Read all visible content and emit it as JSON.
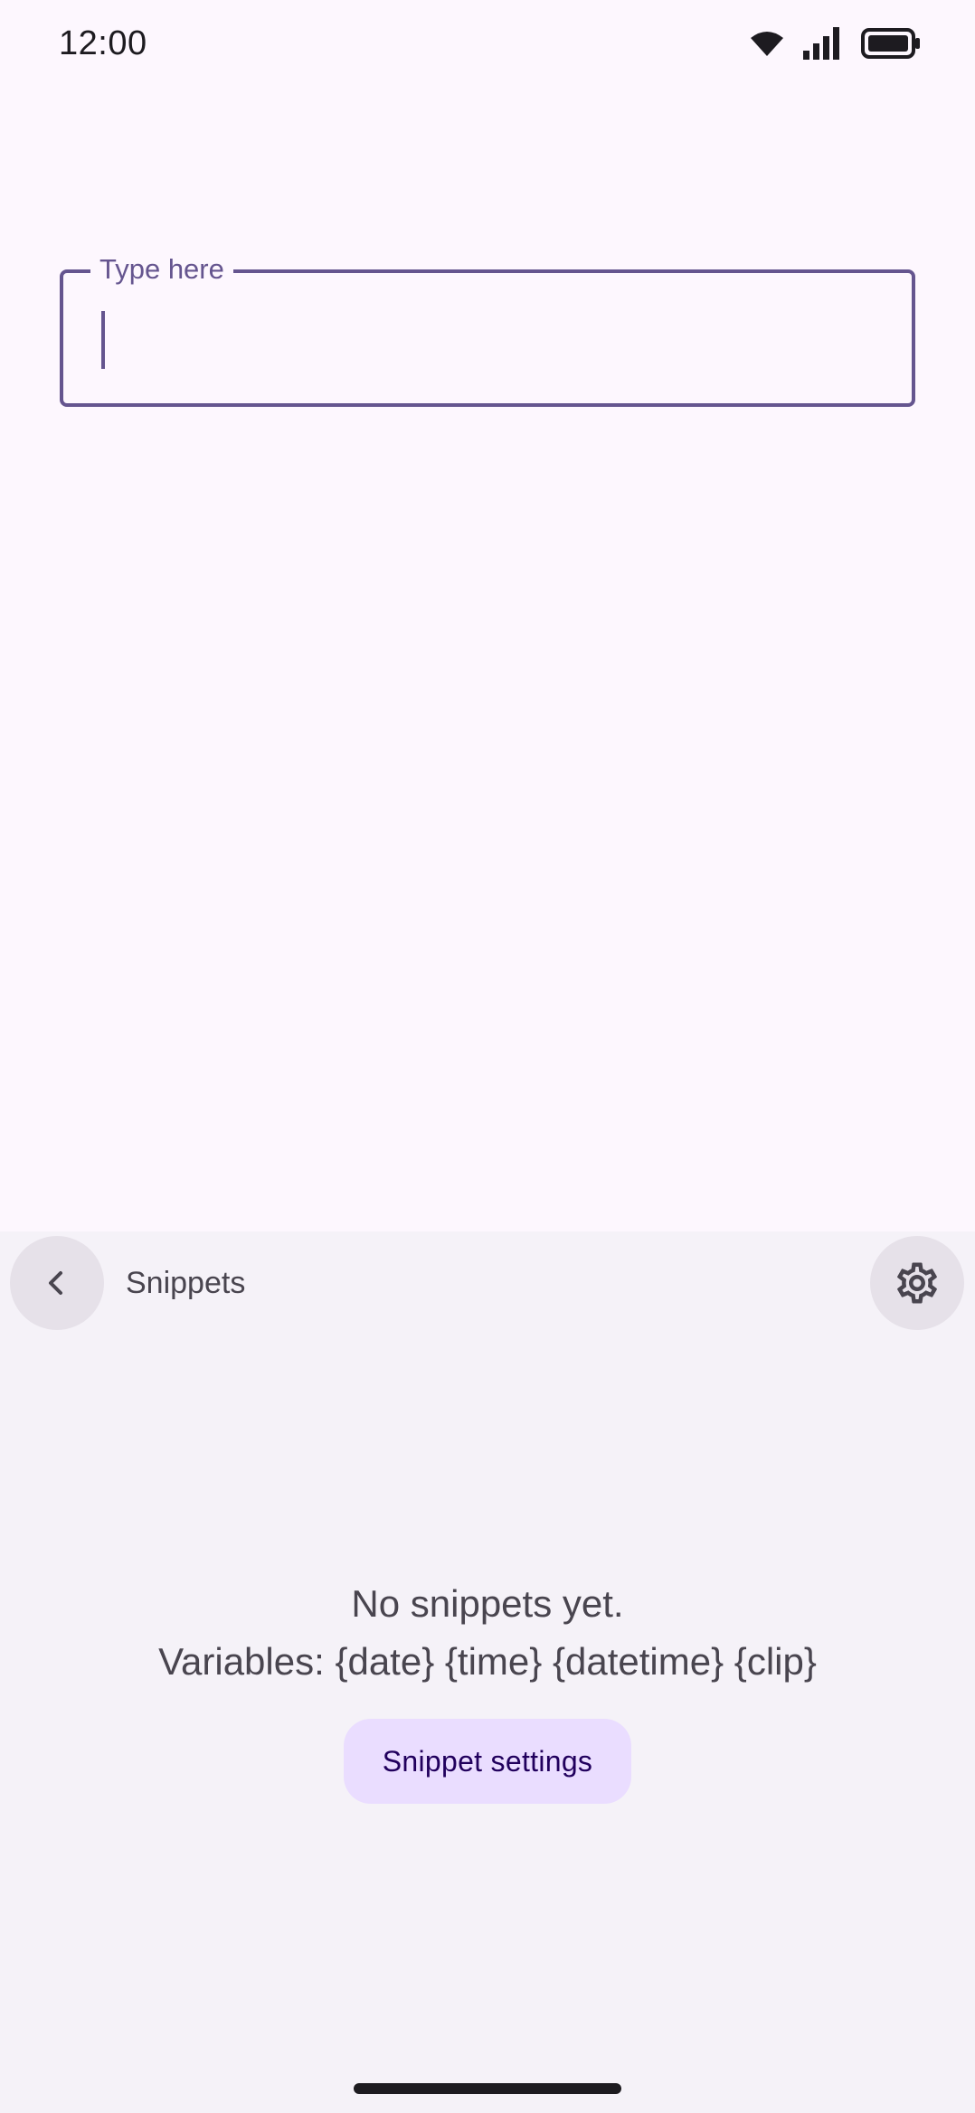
{
  "status_bar": {
    "time": "12:00",
    "icons": [
      "wifi-icon",
      "cell-signal-icon",
      "battery-icon"
    ]
  },
  "text_field": {
    "label": "Type here",
    "value": "",
    "accent_color": "#65558f"
  },
  "panel": {
    "title": "Snippets",
    "back_icon": "chevron-left-icon",
    "settings_icon": "gear-icon",
    "empty_message": "No snippets yet.",
    "variables_hint": "Variables: {date} {time} {datetime} {clip}",
    "action_button_label": "Snippet settings",
    "background_color": "#f5f2f8"
  }
}
